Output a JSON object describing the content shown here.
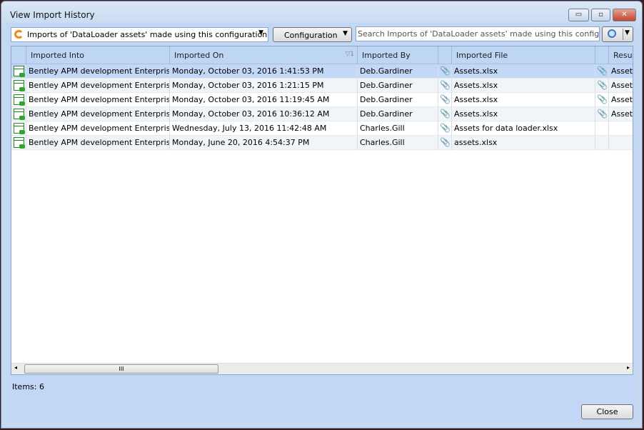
{
  "window": {
    "title": "View Import History",
    "minimize": "▭",
    "maximize": "▫",
    "close": "✕"
  },
  "toolbar": {
    "filter_value": "Imports of 'DataLoader assets' made using this configuration",
    "configuration_label": "Configuration",
    "search_placeholder": "Search Imports of 'DataLoader assets' made using this configuration  ("
  },
  "grid": {
    "columns": [
      "Imported Into",
      "Imported On",
      "Imported By",
      "Imported File",
      "Resul"
    ],
    "sort_indicator": "▽1",
    "rows": [
      {
        "into": "Bentley APM development Enterprise",
        "on": "Monday, October 03, 2016 1:41:53 PM",
        "by": "Deb.Gardiner",
        "file": "Assets.xlsx",
        "result": "Assets"
      },
      {
        "into": "Bentley APM development Enterprise",
        "on": "Monday, October 03, 2016 1:21:15 PM",
        "by": "Deb.Gardiner",
        "file": "Assets.xlsx",
        "result": "Assets"
      },
      {
        "into": "Bentley APM development Enterprise",
        "on": "Monday, October 03, 2016 11:19:45 AM",
        "by": "Deb.Gardiner",
        "file": "Assets.xlsx",
        "result": "Assets"
      },
      {
        "into": "Bentley APM development Enterprise",
        "on": "Monday, October 03, 2016 10:36:12 AM",
        "by": "Deb.Gardiner",
        "file": "Assets.xlsx",
        "result": "Assets"
      },
      {
        "into": "Bentley APM development Enterprise",
        "on": "Wednesday, July 13, 2016 11:42:48 AM",
        "by": "Charles.Gill",
        "file": "Assets for data loader.xlsx",
        "result": ""
      },
      {
        "into": "Bentley APM development Enterprise",
        "on": "Monday, June 20, 2016 4:54:37 PM",
        "by": "Charles.Gill",
        "file": "assets.xlsx",
        "result": ""
      }
    ]
  },
  "footer": {
    "items": "Items: 6",
    "close_label": "Close"
  }
}
